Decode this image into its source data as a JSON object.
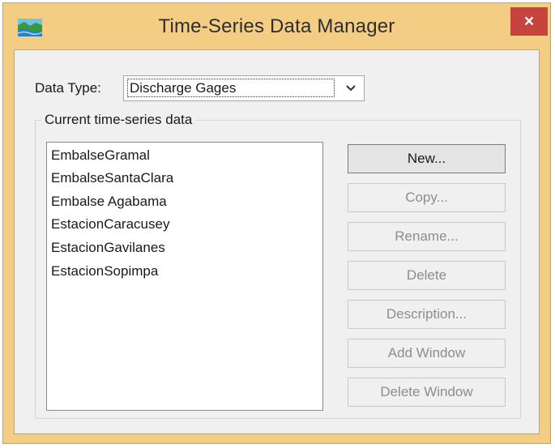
{
  "window": {
    "title": "Time-Series Data Manager",
    "close_label": "×"
  },
  "data_type": {
    "label": "Data Type:",
    "selected": "Discharge Gages"
  },
  "group": {
    "label": "Current time-series data",
    "items": [
      "EmbalseGramal",
      "EmbalseSantaClara",
      "Embalse Agabama",
      "EstacionCaracusey",
      "EstacionGavilanes",
      "EstacionSopimpa"
    ]
  },
  "buttons": {
    "new": "New...",
    "copy": "Copy...",
    "rename": "Rename...",
    "delete": "Delete",
    "description": "Description...",
    "add_window": "Add Window",
    "delete_window": "Delete Window"
  },
  "colors": {
    "frame": "#f4cd85",
    "close": "#c6433e",
    "client": "#f0f0f0"
  },
  "icons": [
    "app-icon",
    "close-icon",
    "chevron-down-icon"
  ]
}
